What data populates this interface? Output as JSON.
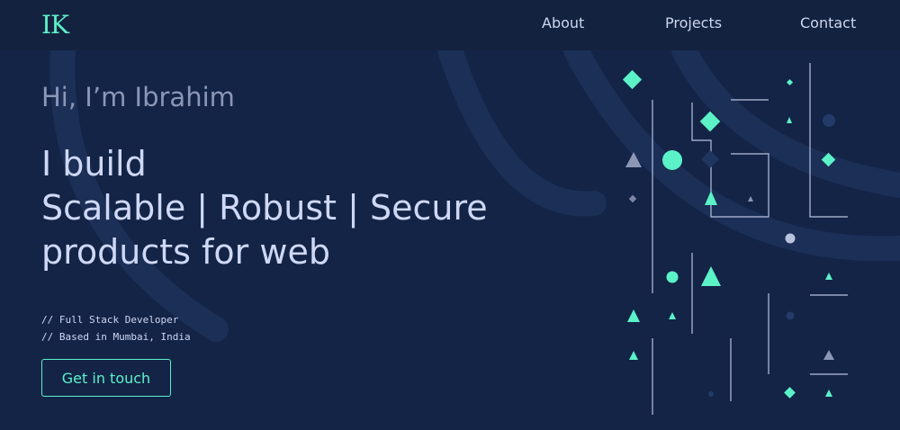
{
  "brand": {
    "logo_text": "IK",
    "accent": "#5cf2c8",
    "background": "#132447"
  },
  "nav": {
    "about": "About",
    "projects": "Projects",
    "contact": "Contact"
  },
  "hero": {
    "greeting": "Hi, I’m Ibrahim",
    "headline": [
      "I build",
      "Scalable | Robust | Secure",
      "products for web"
    ],
    "info": [
      "// Full Stack Developer",
      "// Based in Mumbai, India"
    ],
    "cta_label": "Get in touch"
  }
}
